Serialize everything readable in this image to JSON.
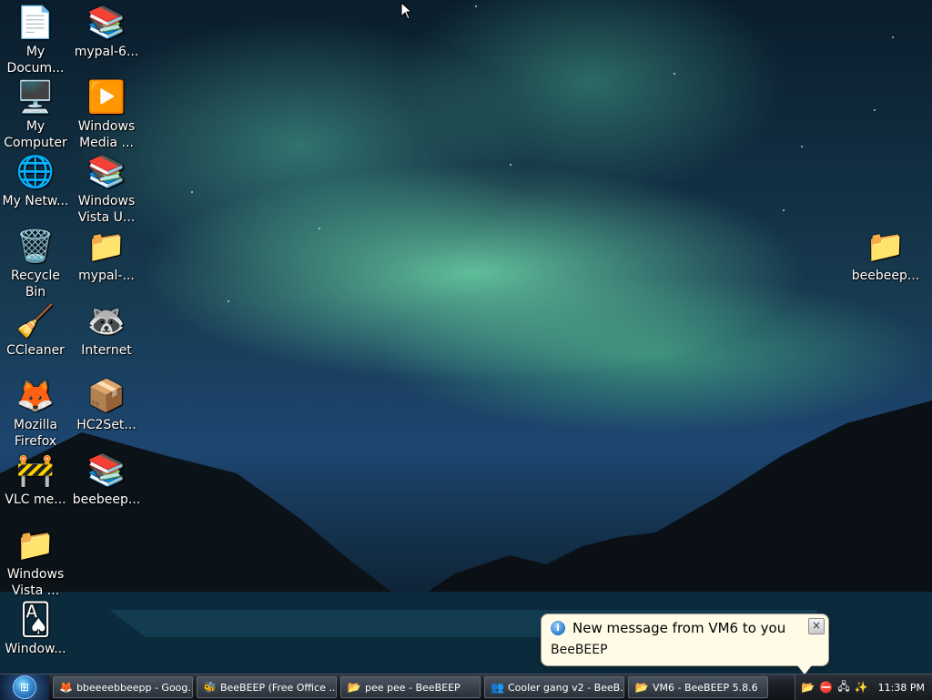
{
  "desktop": {
    "icons": [
      {
        "label": "My Docum...",
        "icon": "my-documents-icon",
        "glyph": "📄"
      },
      {
        "label": "mypal-6...",
        "icon": "winrar-archive-icon",
        "glyph": "📚"
      },
      {
        "label": "My Computer",
        "icon": "my-computer-icon",
        "glyph": "🖥️"
      },
      {
        "label": "Windows Media ...",
        "icon": "windows-media-player-icon",
        "glyph": "▶️"
      },
      {
        "label": "My Netw...",
        "icon": "my-network-places-icon",
        "glyph": "🌐"
      },
      {
        "label": "Windows Vista U...",
        "icon": "winrar-archive-icon",
        "glyph": "📚"
      },
      {
        "label": "Recycle Bin",
        "icon": "recycle-bin-icon",
        "glyph": "🗑️"
      },
      {
        "label": "mypal-...",
        "icon": "folder-icon",
        "glyph": "📁"
      },
      {
        "label": "CCleaner",
        "icon": "ccleaner-icon",
        "glyph": "🧹"
      },
      {
        "label": "Internet",
        "icon": "raccoon-internet-icon",
        "glyph": "🦝"
      },
      {
        "label": "Mozilla Firefox",
        "icon": "firefox-icon",
        "glyph": "🦊"
      },
      {
        "label": "HC2Set...",
        "icon": "installer-box-icon",
        "glyph": "📦"
      },
      {
        "label": "VLC me...",
        "icon": "vlc-cone-icon",
        "glyph": "🚧"
      },
      {
        "label": "beebeep...",
        "icon": "winrar-archive-icon",
        "glyph": "📚"
      },
      {
        "label": "Windows Vista ...",
        "icon": "folder-icon",
        "glyph": "📁"
      },
      {
        "label": "Window...",
        "icon": "solitaire-card-icon",
        "glyph": "🂡"
      },
      {
        "label": "beebeep...",
        "icon": "folder-icon",
        "glyph": "📁"
      }
    ]
  },
  "taskbar": {
    "start_label": "⊞",
    "items": [
      {
        "label": "bbeeeebbeepp - Goog...",
        "icon": "firefox-icon",
        "glyph": "🦊"
      },
      {
        "label": "BeeBEEP (Free Office ...",
        "icon": "beebeep-icon",
        "glyph": "🐝"
      },
      {
        "label": "pee pee - BeeBEEP",
        "icon": "beebeep-folder-icon",
        "glyph": "📂"
      },
      {
        "label": "Cooler gang v2 - BeeB...",
        "icon": "beebeep-group-icon",
        "glyph": "👥"
      },
      {
        "label": "VM6 - BeeBEEP 5.8.6",
        "icon": "beebeep-folder-icon",
        "glyph": "📂"
      }
    ],
    "tray": {
      "icons": [
        {
          "icon": "beebeep-tray-icon",
          "glyph": "📂"
        },
        {
          "icon": "security-shield-icon",
          "glyph": "⛔"
        },
        {
          "icon": "network-icon",
          "glyph": "🖧"
        },
        {
          "icon": "wand-icon",
          "glyph": "✨"
        }
      ],
      "clock": "11:38 PM"
    }
  },
  "notification": {
    "title": "New message from VM6 to you",
    "body": "BeeBEEP",
    "info_glyph": "i",
    "close_glyph": "×"
  },
  "colors": {
    "aurora": "#6fe0a8",
    "sky": "#173a50",
    "balloon_bg": "#fffbe6",
    "taskbar": "#1c2027"
  }
}
